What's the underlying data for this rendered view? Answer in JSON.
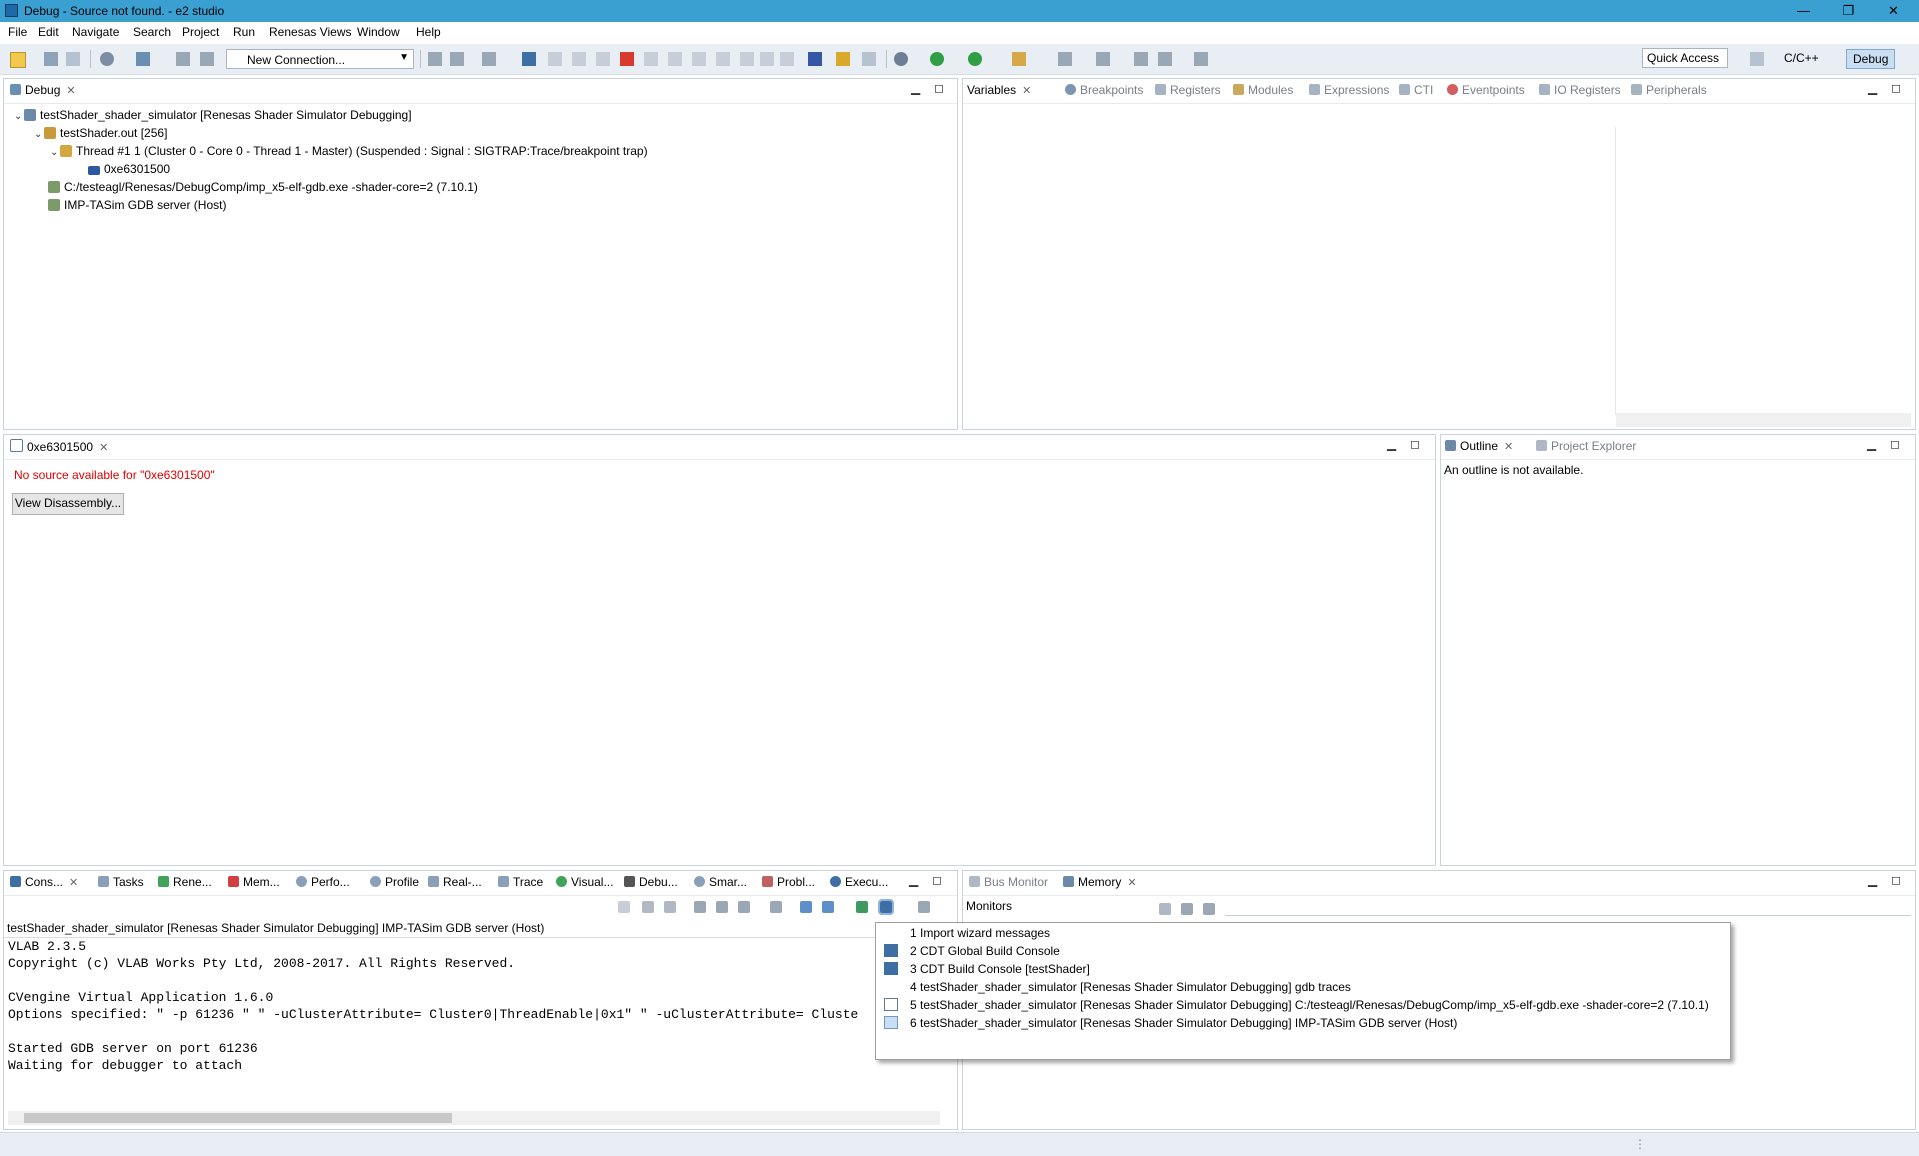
{
  "window": {
    "title": "Debug - Source not found. - e2 studio",
    "min": "—",
    "max": "❐",
    "close": "✕"
  },
  "menu": [
    "File",
    "Edit",
    "Navigate",
    "Search",
    "Project",
    "Run",
    "Renesas Views",
    "Window",
    "Help"
  ],
  "toolbar": {
    "connection": "New Connection...",
    "quick_access": "Quick Access",
    "persp_cpp": "C/C++",
    "persp_debug": "Debug"
  },
  "debug_view": {
    "tab": "Debug",
    "tree": [
      "testShader_shader_simulator [Renesas Shader Simulator Debugging]",
      "testShader.out [256]",
      "Thread #1 1 (Cluster 0 - Core 0 - Thread 1 - Master) (Suspended : Signal : SIGTRAP:Trace/breakpoint trap)",
      "0xe6301500",
      "C:/testeagl/Renesas/DebugComp/imp_x5-elf-gdb.exe -shader-core=2 (7.10.1)",
      "IMP-TASim GDB server (Host)"
    ]
  },
  "vars_view": {
    "tabs": [
      "Variables",
      "Breakpoints",
      "Registers",
      "Modules",
      "Expressions",
      "CTI",
      "Eventpoints",
      "IO Registers",
      "Peripherals"
    ]
  },
  "editor": {
    "tab": "0xe6301500",
    "message": "No source available for \"0xe6301500\"",
    "button": "View Disassembly..."
  },
  "outline": {
    "tabs": [
      "Outline",
      "Project Explorer"
    ],
    "message": "An outline is not available."
  },
  "console": {
    "tabs": [
      "Cons...",
      "Tasks",
      "Rene...",
      "Mem...",
      "Perfo...",
      "Profile",
      "Real-...",
      "Trace",
      "Visual...",
      "Debu...",
      "Smar...",
      "Probl...",
      "Execu..."
    ],
    "header": "testShader_shader_simulator [Renesas Shader Simulator Debugging] IMP-TASim GDB server (Host)",
    "lines": [
      "VLAB 2.3.5",
      "Copyright (c) VLAB Works Pty Ltd, 2008-2017. All Rights Reserved.",
      "",
      "CVengine Virtual Application 1.6.0",
      "Options specified: \" -p 61236 \" \" -uClusterAttribute= Cluster0|ThreadEnable|0x1\" \" -uClusterAttribute= Cluste",
      "",
      "Started GDB server on port 61236",
      "Waiting for debugger to attach"
    ]
  },
  "memory": {
    "tabs": [
      "Bus Monitor",
      "Memory"
    ],
    "monitors": "Monitors"
  },
  "console_menu": [
    "1 Import wizard messages",
    "2 CDT Global Build Console",
    "3 CDT Build Console [testShader]",
    "4 testShader_shader_simulator [Renesas Shader Simulator Debugging] gdb traces",
    "5 testShader_shader_simulator [Renesas Shader Simulator Debugging] C:/testeagl/Renesas/DebugComp/imp_x5-elf-gdb.exe -shader-core=2 (7.10.1)",
    "6 testShader_shader_simulator [Renesas Shader Simulator Debugging] IMP-TASim GDB server (Host)"
  ],
  "colors": {
    "titlebar": "#3aa0d2",
    "toolbar": "#e9eef4",
    "error": "#e00000",
    "selection": "#c9def2"
  }
}
